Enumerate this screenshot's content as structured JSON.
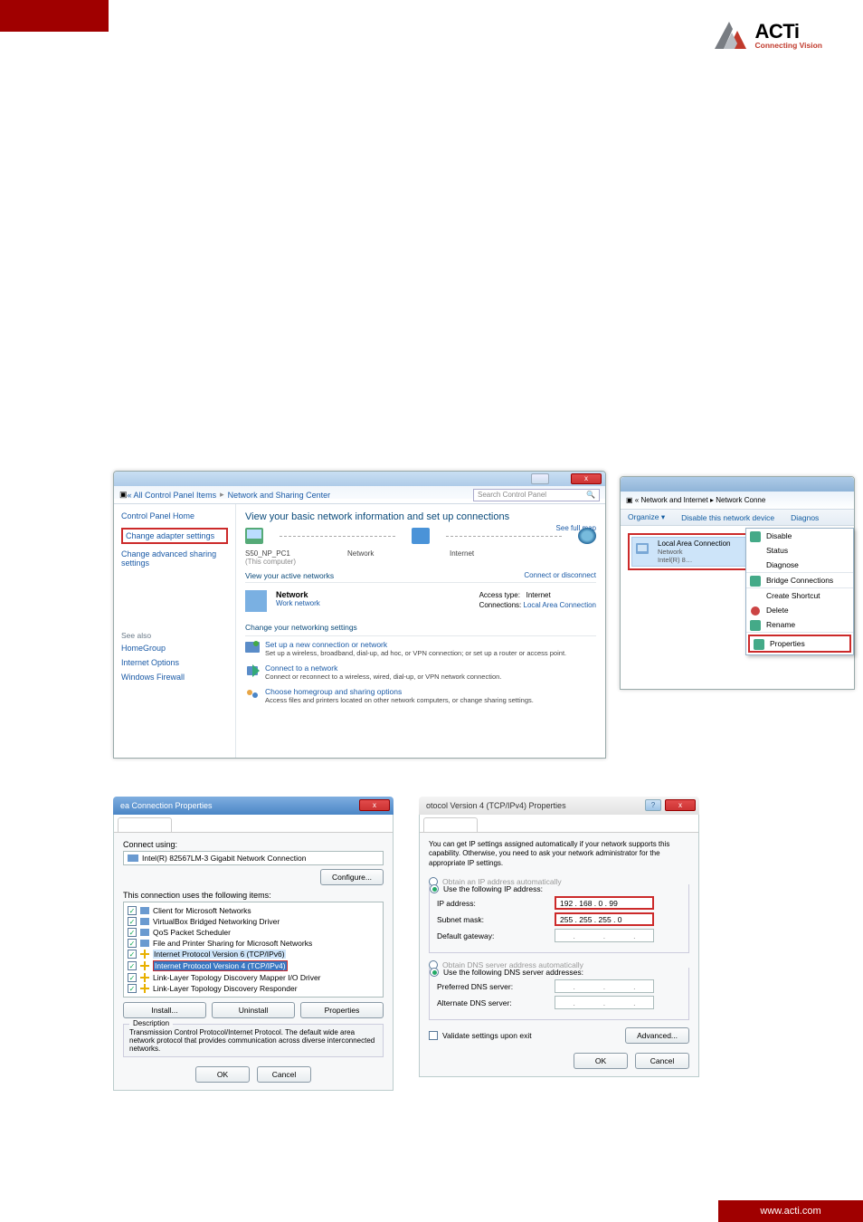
{
  "logo": {
    "main": "ACTi",
    "sub": "Connecting Vision"
  },
  "footer": "www.acti.com",
  "ns": {
    "breadcrumb": [
      "« All Control Panel Items",
      "Network and Sharing Center"
    ],
    "search_ph": "Search Control Panel",
    "left": {
      "home": "Control Panel Home",
      "adapter": "Change adapter settings",
      "advanced": "Change advanced sharing settings",
      "seealso": "See also",
      "hg": "HomeGroup",
      "io": "Internet Options",
      "wf": "Windows Firewall"
    },
    "main": {
      "hdr": "View your basic network information and set up connections",
      "fullmap": "See full map",
      "pc": "S50_NP_PC1",
      "pc_sub": "(This computer)",
      "net": "Network",
      "inet": "Internet",
      "van": "View your active networks",
      "conn_dis": "Connect or disconnect",
      "network_name": "Network",
      "network_type": "Work network",
      "access_type_l": "Access type:",
      "access_type_v": "Internet",
      "connections_l": "Connections:",
      "connections_v": "Local Area Connection",
      "cns": "Change your networking settings",
      "a1t": "Set up a new connection or network",
      "a1d": "Set up a wireless, broadband, dial-up, ad hoc, or VPN connection; or set up a router or access point.",
      "a2t": "Connect to a network",
      "a2d": "Connect or reconnect to a wireless, wired, dial-up, or VPN network connection.",
      "a3t": "Choose homegroup and sharing options",
      "a3d": "Access files and printers located on other network computers, or change sharing settings."
    }
  },
  "nc": {
    "bread": "« Network and Internet  ▸  Network Conne",
    "organize": "Organize ▾",
    "disable_dev": "Disable this network device",
    "diagnos": "Diagnos",
    "conn": {
      "name": "Local Area Connection",
      "l2": "Network",
      "l3": "Intel(R) 8…"
    },
    "ctx": {
      "disable": "Disable",
      "status": "Status",
      "diagnose": "Diagnose",
      "bridge": "Bridge Connections",
      "shortcut": "Create Shortcut",
      "delete": "Delete",
      "rename": "Rename",
      "properties": "Properties"
    }
  },
  "props": {
    "title": "ea Connection Properties",
    "tab": "",
    "connect_using": "Connect using:",
    "adapter": "Intel(R) 82567LM-3 Gigabit Network Connection",
    "configure": "Configure...",
    "items_label": "This connection uses the following items:",
    "items": [
      "Client for Microsoft Networks",
      "VirtualBox Bridged Networking Driver",
      "QoS Packet Scheduler",
      "File and Printer Sharing for Microsoft Networks",
      "Internet Protocol Version 6 (TCP/IPv6)",
      "Internet Protocol Version 4 (TCP/IPv4)",
      "Link-Layer Topology Discovery Mapper I/O Driver",
      "Link-Layer Topology Discovery Responder"
    ],
    "install": "Install...",
    "uninstall": "Uninstall",
    "properties": "Properties",
    "desc_label": "Description",
    "desc": "Transmission Control Protocol/Internet Protocol. The default wide area network protocol that provides communication across diverse interconnected networks.",
    "ok": "OK",
    "cancel": "Cancel"
  },
  "ipv4": {
    "title": "otocol Version 4 (TCP/IPv4) Properties",
    "intro": "You can get IP settings assigned automatically if your network supports this capability. Otherwise, you need to ask your network administrator for the appropriate IP settings.",
    "auto_ip": "Obtain an IP address automatically",
    "use_ip": "Use the following IP address:",
    "ip_l": "IP address:",
    "ip_v": "192 . 168 .   0  .  99",
    "sm_l": "Subnet mask:",
    "sm_v": "255 . 255 . 255 .   0",
    "gw_l": "Default gateway:",
    "auto_dns": "Obtain DNS server address automatically",
    "use_dns": "Use the following DNS server addresses:",
    "pdns_l": "Preferred DNS server:",
    "adns_l": "Alternate DNS server:",
    "validate": "Validate settings upon exit",
    "advanced": "Advanced...",
    "ok": "OK",
    "cancel": "Cancel"
  }
}
